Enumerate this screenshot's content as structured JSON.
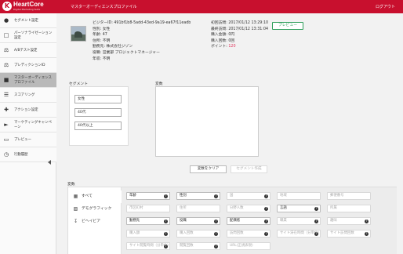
{
  "header": {
    "logo_text": "HeartCore",
    "logo_sub": "Digital Marketing Suite",
    "title": "マスターオーディエンスプロファイル",
    "logout": "ログアウト"
  },
  "sidebar": {
    "items": [
      {
        "label": "セグメント設定",
        "icon": "users-icon"
      },
      {
        "label": "パーソナライゼーション設定",
        "icon": "document-icon"
      },
      {
        "label": "A/Bテスト設定",
        "icon": "scale-icon"
      },
      {
        "label": "プレディクションID",
        "icon": "scale-icon"
      },
      {
        "label": "マスターオーディエンスプロファイル",
        "icon": "person-icon"
      },
      {
        "label": "スコアリング",
        "icon": "list-icon"
      },
      {
        "label": "アクション設定",
        "icon": "arrows-icon"
      },
      {
        "label": "マーケティングキャンペーン",
        "icon": "megaphone-icon"
      },
      {
        "label": "プレビュー",
        "icon": "monitor-icon"
      },
      {
        "label": "行動履歴",
        "icon": "clock-icon"
      }
    ]
  },
  "profile": {
    "visitor_id": "ビジターID: 491bf1b8-5add-43ed-9a19-ea67f11eadb",
    "gender": "性別: 女性",
    "age": "年齢: 47",
    "address": "住所: 不明",
    "company": "勤務先: 株式会社ジゾン",
    "job": "役職: 営業部 プロジェクトマネージャー",
    "income": "年収: 不明"
  },
  "stats": {
    "first_visit": "初回訪問: 2017/01/12 13:29:10",
    "last_visit": "最終訪問: 2017/01/12 13:31:04",
    "purchase_amount": "購入金額: 0円",
    "purchase_count": "購入回数: 0回",
    "points_label": "ポイント: ",
    "points_value": "120"
  },
  "preview_button": "プレビュー",
  "segment": {
    "title": "セグメント",
    "items": [
      "女性",
      "40代",
      "40代以上"
    ]
  },
  "variables": {
    "title": "変数",
    "clear_button": "変数をクリア",
    "create_button": "セグメント作成"
  },
  "variables_bottom": {
    "title": "変数",
    "tabs": [
      {
        "label": "すべて",
        "icon": "grid-icon"
      },
      {
        "label": "デモグラフィック",
        "icon": "chart-icon"
      },
      {
        "label": "ビヘイビア",
        "icon": "download-icon"
      }
    ],
    "pills": [
      {
        "label": "年齢",
        "style": "dark",
        "q": true
      },
      {
        "label": "性別",
        "style": "dark",
        "q": true
      },
      {
        "label": "国",
        "style": "light",
        "q": true
      },
      {
        "label": "地域",
        "style": "light",
        "q": false
      },
      {
        "label": "郵便番号",
        "style": "light",
        "q": false
      },
      {
        "label": "市区町村",
        "style": "light",
        "q": false
      },
      {
        "label": "住所",
        "style": "light",
        "q": false
      },
      {
        "label": "分野人数",
        "style": "light",
        "q": true
      },
      {
        "label": "言語",
        "style": "dark",
        "q": true
      },
      {
        "label": "所属",
        "style": "light",
        "q": false
      },
      {
        "label": "勤務先",
        "style": "dark",
        "q": true
      },
      {
        "label": "役職",
        "style": "dark",
        "q": true
      },
      {
        "label": "配偶者",
        "style": "dark",
        "q": true
      },
      {
        "label": "職業",
        "style": "light",
        "q": true
      },
      {
        "label": "趣味",
        "style": "light",
        "q": true
      },
      {
        "label": "購入額",
        "style": "light",
        "q": true
      },
      {
        "label": "購入回数",
        "style": "light",
        "q": true
      },
      {
        "label": "訪問回数",
        "style": "light",
        "q": true
      },
      {
        "label": "サイト滞在時間（分単位）",
        "style": "light",
        "q": true
      },
      {
        "label": "サイト訪問回数",
        "style": "light",
        "q": true
      },
      {
        "label": "サイト閲覧時間（分単位）",
        "style": "light",
        "q": true
      },
      {
        "label": "閲覧回数",
        "style": "light",
        "q": true
      },
      {
        "label": "URL(正規表現)",
        "style": "light",
        "q": false
      }
    ]
  },
  "colors": {
    "brand": "#c8102e",
    "accent_green": "#2e9e5a",
    "points": "#e0315a"
  }
}
